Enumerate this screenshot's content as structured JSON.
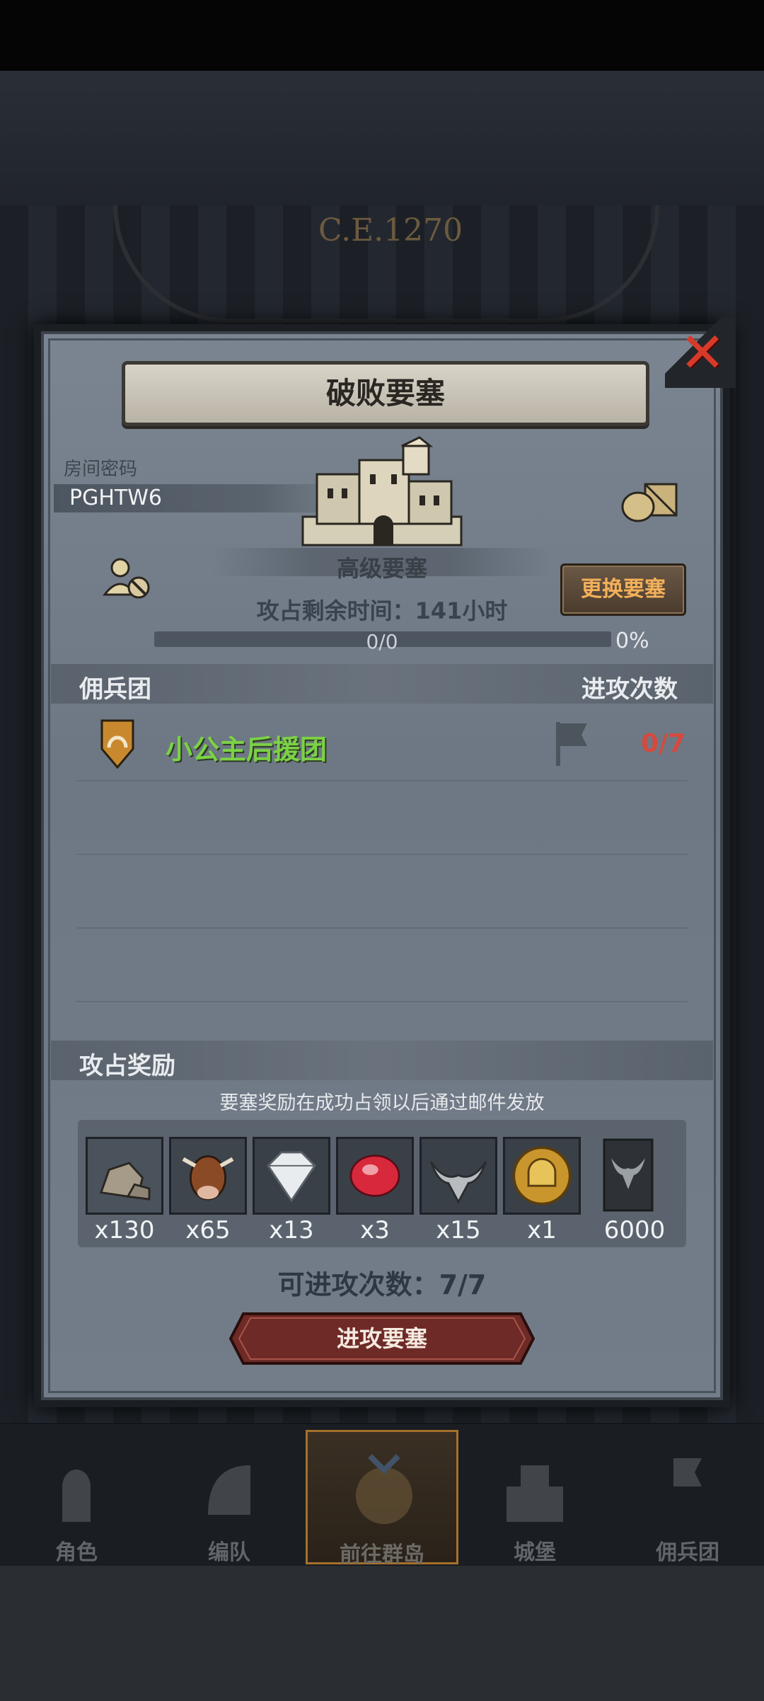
{
  "background": {
    "era_text": "C.E.1270"
  },
  "modal": {
    "title": "破败要塞",
    "room": {
      "label": "房间密码",
      "code": "PGHTW6"
    },
    "fortress": {
      "name": "高级要塞"
    },
    "change_button": "更换要塞",
    "timer": "攻占剩余时间：141小时",
    "progress": {
      "text": "0/0",
      "percent": "0%"
    },
    "mercenary": {
      "header": "佣兵团",
      "attacks_header": "进攻次数",
      "guilds": [
        {
          "name": "小公主后援团",
          "attacks": "0/7"
        }
      ]
    },
    "rewards": {
      "header": "攻占奖励",
      "note": "要塞奖励在成功占领以后通过邮件发放",
      "items": [
        {
          "icon": "stone-icon",
          "count": "x130"
        },
        {
          "icon": "cow-icon",
          "count": "x65"
        },
        {
          "icon": "diamond-icon",
          "count": "x13"
        },
        {
          "icon": "ruby-icon",
          "count": "x3"
        },
        {
          "icon": "bull-horn-icon",
          "count": "x15"
        },
        {
          "icon": "gold-helmet-coin-icon",
          "count": "x1"
        },
        {
          "icon": "bull-banner-icon",
          "count": "6000"
        }
      ]
    },
    "attack_count": "可进攻次数：7/7",
    "attack_button": "进攻要塞"
  },
  "nav": {
    "items": [
      {
        "label": "角色",
        "icon": "knight-icon"
      },
      {
        "label": "编队",
        "icon": "helmet-icon"
      },
      {
        "label": "前往群岛",
        "icon": "island-icon",
        "active": true
      },
      {
        "label": "城堡",
        "icon": "castle-icon"
      },
      {
        "label": "佣兵团",
        "icon": "banner-icon"
      }
    ]
  },
  "colors": {
    "guild_name": "#7bd245",
    "attack_count_red": "#d44a3e",
    "change_button_text": "#f2b05a",
    "close_red": "#d83a2a"
  }
}
